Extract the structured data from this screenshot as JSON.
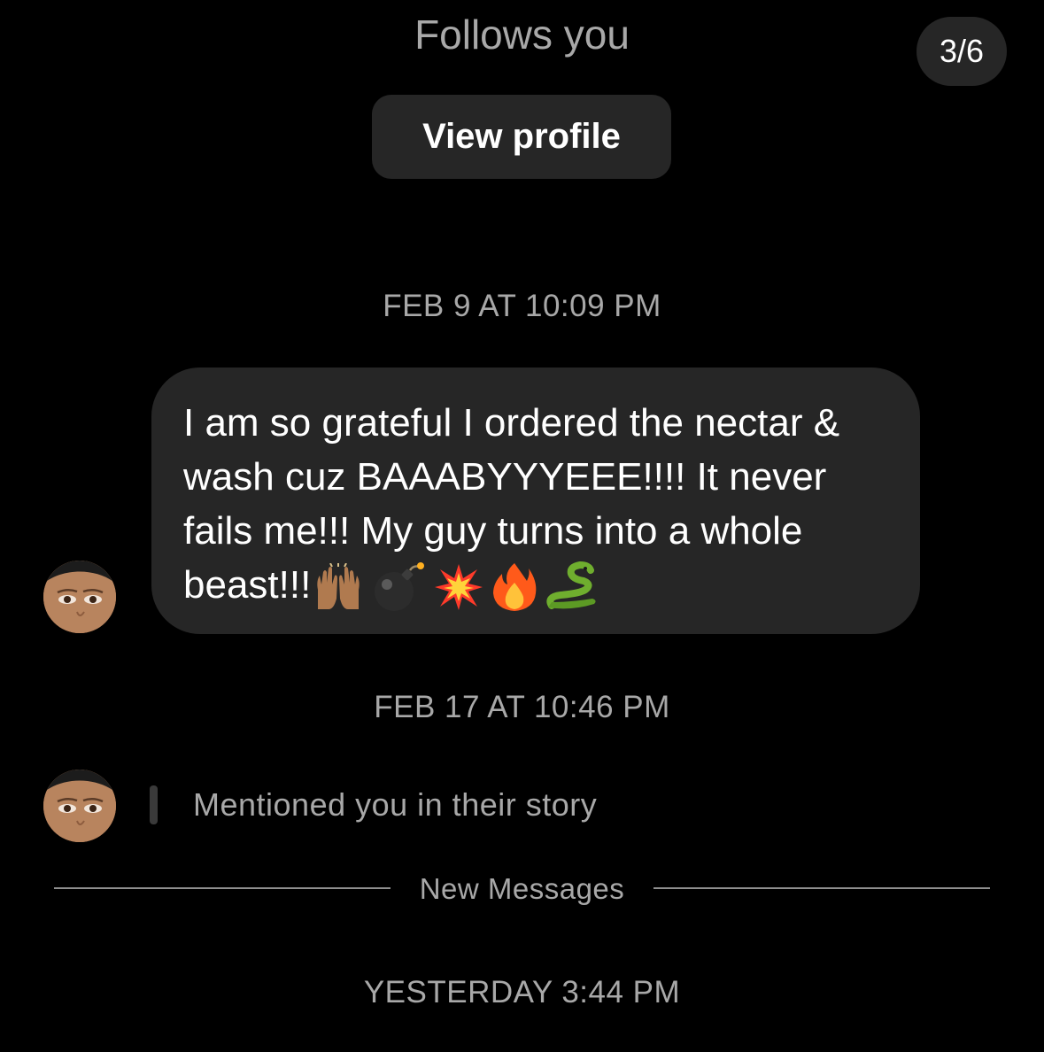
{
  "header": {
    "follows_label": "Follows you",
    "view_profile_label": "View profile",
    "page_counter": "3/6"
  },
  "thread": {
    "timestamps": [
      "FEB 9 AT 10:09 PM",
      "FEB 17 AT 10:46 PM",
      "YESTERDAY 3:44 PM"
    ],
    "message": {
      "text": "I am so grateful I ordered the nectar & wash cuz BAAABYYYEEE!!!! It never fails me!!! My guy turns into a whole beast!!!",
      "emojis": [
        "raising-hands-icon",
        "bomb-icon",
        "collision-icon",
        "fire-icon",
        "snake-icon"
      ]
    },
    "story_mention": "Mentioned you in their story",
    "new_messages_label": "New Messages"
  },
  "colors": {
    "background": "#000000",
    "bubble": "#262626",
    "muted_text": "#a8a8a8",
    "primary_text": "#ffffff"
  }
}
